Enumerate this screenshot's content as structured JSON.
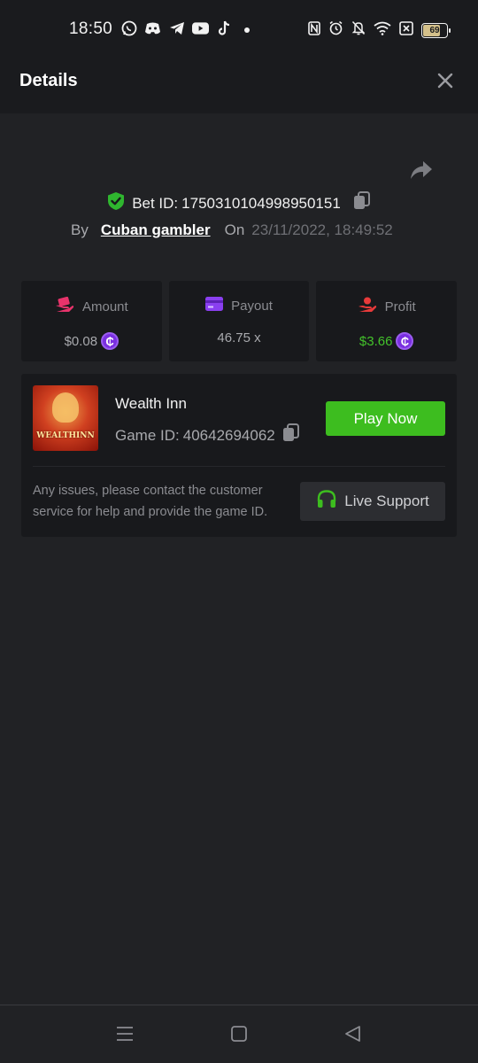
{
  "status_bar": {
    "time": "18:50",
    "battery": "69",
    "app_icons": [
      "whatsapp-icon",
      "discord-icon",
      "telegram-icon",
      "youtube-icon",
      "tiktok-icon"
    ],
    "system_icons": [
      "nfc-icon",
      "alarm-icon",
      "mute-icon",
      "wifi-icon",
      "sim-icon",
      "battery-icon"
    ]
  },
  "header": {
    "title": "Details"
  },
  "bet": {
    "id_label": "Bet ID:",
    "id_value": "1750310104998950151",
    "by_label": "By",
    "user": "Cuban gambler",
    "on_label": "On",
    "date": "23/11/2022, 18:49:52"
  },
  "stats": {
    "amount": {
      "label": "Amount",
      "value": "$0.08",
      "currency_symbol": "₵"
    },
    "payout": {
      "label": "Payout",
      "value": "46.75 x"
    },
    "profit": {
      "label": "Profit",
      "value": "$3.66",
      "currency_symbol": "₵"
    }
  },
  "game": {
    "name": "Wealth Inn",
    "id_label": "Game ID:",
    "id_value": "40642694062",
    "thumb_text": "WEALTHINN",
    "play_label": "Play Now",
    "support_text": "Any issues, please contact the customer service for help and provide the game ID.",
    "live_support_label": "Live Support"
  },
  "colors": {
    "background": "#212225",
    "panel": "#18191c",
    "play_green": "#3dbd1f",
    "profit_green": "#43c22b",
    "coin_purple": "#7a2fe0",
    "shield_green": "#2fb62f"
  }
}
